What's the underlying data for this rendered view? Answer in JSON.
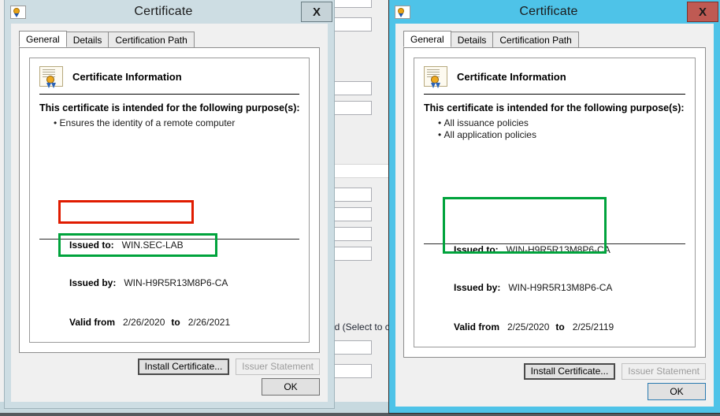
{
  "background": {
    "partial_label": "ed (Select to c",
    "bottom_pink_text": "",
    "fields_count": 10
  },
  "dialogs": [
    {
      "id": "left",
      "state": "inactive",
      "title": "Certificate",
      "icon": "certificate-icon",
      "close_label": "X",
      "tabs": [
        {
          "label": "General",
          "selected": true
        },
        {
          "label": "Details",
          "selected": false
        },
        {
          "label": "Certification Path",
          "selected": false
        }
      ],
      "info_heading": "Certificate Information",
      "purpose_title": "This certificate is intended for the following purpose(s):",
      "purposes": [
        "Ensures the identity of a remote computer"
      ],
      "issued_to_label": "Issued to:",
      "issued_to_value": "WIN.SEC-LAB",
      "issued_by_label": "Issued by:",
      "issued_by_value": "WIN-H9R5R13M8P6-CA",
      "valid_from_label": "Valid from",
      "valid_from_value": "2/26/2020",
      "valid_to_label": "to",
      "valid_to_value": "2/26/2021",
      "install_button": "Install Certificate...",
      "issuer_button": "Issuer Statement",
      "ok_button": "OK",
      "highlights": [
        {
          "name": "issued-to-highlight",
          "color": "#e01b00"
        },
        {
          "name": "issued-by-highlight",
          "color": "#00a33c"
        }
      ]
    },
    {
      "id": "right",
      "state": "active",
      "title": "Certificate",
      "icon": "certificate-icon",
      "close_label": "X",
      "tabs": [
        {
          "label": "General",
          "selected": true
        },
        {
          "label": "Details",
          "selected": false
        },
        {
          "label": "Certification Path",
          "selected": false
        }
      ],
      "info_heading": "Certificate Information",
      "purpose_title": "This certificate is intended for the following purpose(s):",
      "purposes": [
        "All issuance policies",
        "All application policies"
      ],
      "issued_to_label": "Issued to:",
      "issued_to_value": "WIN-H9R5R13M8P6-CA",
      "issued_by_label": "Issued by:",
      "issued_by_value": "WIN-H9R5R13M8P6-CA",
      "valid_from_label": "Valid from",
      "valid_from_value": "2/25/2020",
      "valid_to_label": "to",
      "valid_to_value": "2/25/2119",
      "install_button": "Install Certificate...",
      "issuer_button": "Issuer Statement",
      "ok_button": "OK",
      "highlights": [
        {
          "name": "issued-to-by-highlight",
          "color": "#00a33c"
        }
      ]
    }
  ],
  "colors": {
    "active_titlebar": "#4ec3e8",
    "inactive_titlebar": "#cdddE3",
    "close_active": "#bf5a53",
    "close_inactive": "#c6d3d8",
    "highlight_red": "#e01b00",
    "highlight_green": "#00a33c",
    "dialog_face": "#f0f0f0"
  }
}
